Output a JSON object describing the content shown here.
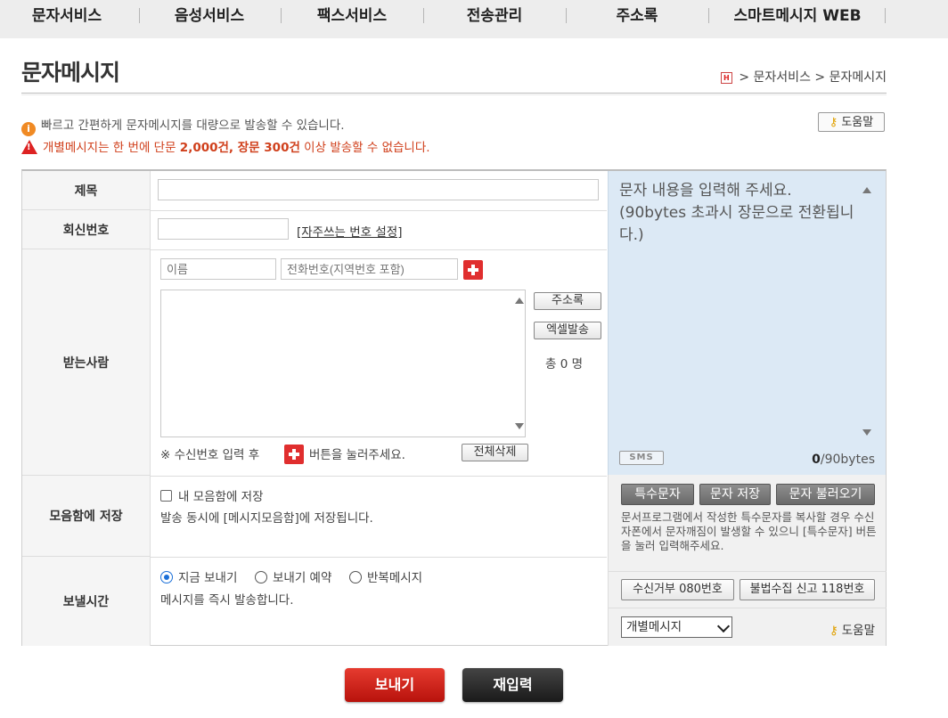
{
  "nav": {
    "items": [
      "문자서비스",
      "음성서비스",
      "팩스서비스",
      "전송관리",
      "주소록",
      "스마트메시지 WEB"
    ]
  },
  "page": {
    "title": "문자메시지",
    "breadcrumb": [
      "문자서비스",
      "문자메시지"
    ],
    "breadcrumb_sep": ">",
    "home_icon": "H"
  },
  "info": {
    "line1": "빠르고 간편하게 문자메시지를 대량으로 발송할 수 있습니다.",
    "line2_prefix": "개별메시지는 한 번에 단문 ",
    "line2_bold": "2,000건, 장문 300건",
    "line2_suffix": " 이상 발송할 수 없습니다.",
    "help_label": "도움말"
  },
  "form": {
    "subject_label": "제목",
    "subject_value": "",
    "reply_label": "회신번호",
    "reply_value": "",
    "freq_number_link": "[자주쓰는 번호 설정]",
    "recipient_label": "받는사람",
    "name_placeholder": "이름",
    "phone_placeholder": "전화번호(지역번호 포함)",
    "address_book_btn": "주소록",
    "excel_btn": "엑셀발송",
    "total_count": "총 0 명",
    "hint_prefix": "※ 수신번호 입력 후",
    "hint_suffix": "버튼을 눌러주세요.",
    "delete_all_btn": "전체삭제",
    "save_label": "모음함에 저장",
    "save_checkbox_label": "내 모음함에 저장",
    "save_note": "발송 동시에 [메시지모음함]에 저장됩니다.",
    "send_time_label": "보낼시간",
    "send_options": [
      "지금 보내기",
      "보내기 예약",
      "반복메시지"
    ],
    "send_selected": "지금 보내기",
    "send_note": "메시지를 즉시 발송합니다."
  },
  "message": {
    "placeholder": "문자 내용을 입력해 주세요. (90bytes 초과시 장문으로 전환됩니다.)",
    "type_badge": "SMS",
    "byte_count": "0",
    "byte_limit": "/90bytes",
    "special_char_btn": "특수문자",
    "save_msg_btn": "문자 저장",
    "load_msg_btn": "문자 불러오기",
    "note": "문서프로그램에서 작성한 특수문자를 복사할 경우 수신자폰에서 문자깨짐이 발생할 수 있으니 [특수문자] 버튼을 눌러 입력해주세요.",
    "reject_080_btn": "수신거부 080번호",
    "report_118_btn": "불법수집 신고 118번호",
    "mode_select": "개별메시지",
    "help_label": "도움말"
  },
  "actions": {
    "send": "보내기",
    "reset": "재입력"
  }
}
